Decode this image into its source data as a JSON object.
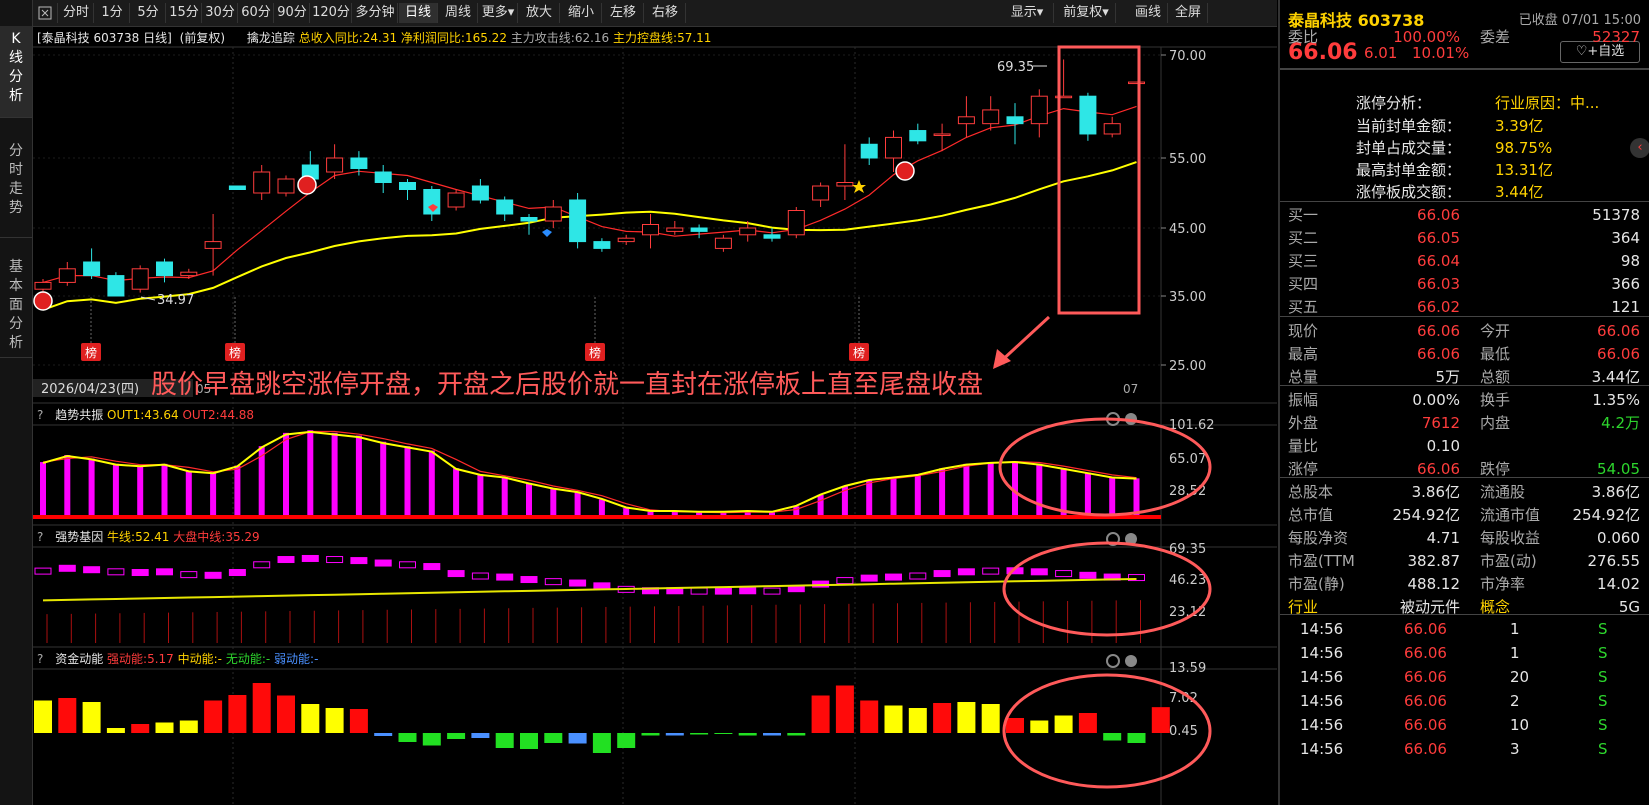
{
  "toolbar": {
    "items": [
      "分时",
      "1分",
      "5分",
      "15分",
      "30分",
      "60分",
      "90分",
      "120分",
      "多分钟",
      "日线",
      "周线",
      "更多▾",
      "放大",
      "缩小",
      "左移",
      "右移"
    ],
    "active": "日线",
    "right_items": [
      "显示▾",
      "前复权▾",
      "画线",
      "全屏"
    ]
  },
  "left_tabs": [
    "K\n线\n分\n析",
    "分\n时\n走\n势",
    "基\n本\n面\n分\n析"
  ],
  "chart": {
    "title": "[泰晶科技 603738 日线]",
    "adjust": "(前复权)",
    "indicator_name": "擒龙追踪",
    "ind1": "总收入同比:24.31",
    "ind2": "净利润同比:165.22",
    "ind3": "主力攻击线:62.16",
    "ind4": "主力控盘线:57.11",
    "high_label": "69.35",
    "low_label": "34.97",
    "date_label": "2026/04/23(四)",
    "date_tick_mid": "05",
    "date_tick_end": "07",
    "bang": "榜",
    "annotation": "股价早盘跳空涨停开盘，开盘之后股价就一直封在涨停板上直至尾盘收盘",
    "y_ticks": [
      "70.00",
      "55.00",
      "45.00",
      "35.00",
      "25.00"
    ],
    "y_vals": [
      70,
      55,
      45,
      35,
      25
    ]
  },
  "panel1": {
    "name": "趋势共振",
    "out1": "OUT1:43.64",
    "out2": "OUT2:44.88",
    "ticks": [
      "101.62",
      "65.07",
      "28.52"
    ]
  },
  "panel2": {
    "name": "强势基因",
    "l1": "牛线:52.41",
    "l2": "大盘中线:35.29",
    "ticks": [
      "69.35",
      "46.23",
      "23.12"
    ]
  },
  "panel3": {
    "name": "资金动能",
    "l1": "强动能:5.17",
    "l2": "中动能:-",
    "l3": "无动能:-",
    "l4": "弱动能:-",
    "ticks": [
      "13.59",
      "7.02",
      "0.45"
    ]
  },
  "colors": {
    "up": "#ff3c3c",
    "down": "#2ee6e6",
    "ma_red": "#ff2a2a",
    "ma_yellow": "#ffff00",
    "magenta": "#ff00ff",
    "annot": "#ff5a5a"
  },
  "candles": [
    {
      "o": 36,
      "c": 37,
      "h": 37.5,
      "l": 35.5
    },
    {
      "o": 37,
      "c": 39,
      "h": 40,
      "l": 36.5
    },
    {
      "o": 40,
      "c": 38,
      "h": 42,
      "l": 37.5
    },
    {
      "o": 38,
      "c": 35,
      "h": 38.5,
      "l": 34.97
    },
    {
      "o": 36,
      "c": 39,
      "h": 39.5,
      "l": 35.5
    },
    {
      "o": 40,
      "c": 38,
      "h": 40.5,
      "l": 37
    },
    {
      "o": 38,
      "c": 38.5,
      "h": 39,
      "l": 37.5
    },
    {
      "o": 42,
      "c": 43,
      "h": 47,
      "l": 38
    },
    {
      "o": 51,
      "c": 50.5,
      "h": 51,
      "l": 50.5
    },
    {
      "o": 50,
      "c": 53,
      "h": 54,
      "l": 49
    },
    {
      "o": 50,
      "c": 52,
      "h": 52.5,
      "l": 49.5
    },
    {
      "o": 54,
      "c": 52,
      "h": 56,
      "l": 51
    },
    {
      "o": 53,
      "c": 55,
      "h": 57,
      "l": 52
    },
    {
      "o": 55,
      "c": 53.5,
      "h": 56,
      "l": 52.5
    },
    {
      "o": 53,
      "c": 51.5,
      "h": 54,
      "l": 50
    },
    {
      "o": 51.5,
      "c": 50.5,
      "h": 52,
      "l": 49
    },
    {
      "o": 50.5,
      "c": 47,
      "h": 51,
      "l": 46
    },
    {
      "o": 48,
      "c": 50,
      "h": 50.5,
      "l": 47.5
    },
    {
      "o": 51,
      "c": 49,
      "h": 52,
      "l": 48.5
    },
    {
      "o": 49,
      "c": 47,
      "h": 49.5,
      "l": 46
    },
    {
      "o": 46.5,
      "c": 46,
      "h": 47,
      "l": 44
    },
    {
      "o": 46,
      "c": 48,
      "h": 49,
      "l": 45
    },
    {
      "o": 49,
      "c": 43,
      "h": 50,
      "l": 42
    },
    {
      "o": 43,
      "c": 42,
      "h": 43.5,
      "l": 41.5
    },
    {
      "o": 43,
      "c": 43.5,
      "h": 44,
      "l": 42.5
    },
    {
      "o": 44,
      "c": 45.5,
      "h": 47,
      "l": 42
    },
    {
      "o": 44.5,
      "c": 45,
      "h": 46,
      "l": 44
    },
    {
      "o": 45,
      "c": 44.5,
      "h": 45.5,
      "l": 43.5
    },
    {
      "o": 42,
      "c": 43.5,
      "h": 44,
      "l": 41.5
    },
    {
      "o": 44,
      "c": 45,
      "h": 46,
      "l": 43
    },
    {
      "o": 44,
      "c": 43.5,
      "h": 45,
      "l": 43
    },
    {
      "o": 44,
      "c": 47.5,
      "h": 48,
      "l": 43.5
    },
    {
      "o": 49,
      "c": 51,
      "h": 51.5,
      "l": 48
    },
    {
      "o": 51,
      "c": 51.5,
      "h": 57,
      "l": 49
    },
    {
      "o": 57,
      "c": 55,
      "h": 58,
      "l": 54
    },
    {
      "o": 55,
      "c": 58,
      "h": 59,
      "l": 53
    },
    {
      "o": 59,
      "c": 57.5,
      "h": 60,
      "l": 57
    },
    {
      "o": 58.5,
      "c": 58.5,
      "h": 60,
      "l": 56
    },
    {
      "o": 60,
      "c": 61,
      "h": 64,
      "l": 58
    },
    {
      "o": 60,
      "c": 62,
      "h": 64,
      "l": 59
    },
    {
      "o": 61,
      "c": 60,
      "h": 63,
      "l": 57
    },
    {
      "o": 60,
      "c": 64,
      "h": 65,
      "l": 58
    },
    {
      "o": 64,
      "c": 64,
      "h": 69.35,
      "l": 64
    },
    {
      "o": 64,
      "c": 58.5,
      "h": 64.5,
      "l": 57.5
    },
    {
      "o": 58.5,
      "c": 60,
      "h": 61,
      "l": 58
    },
    {
      "o": 66.06,
      "c": 66.06,
      "h": 66.06,
      "l": 66.06
    }
  ],
  "macd": [
    62,
    70,
    66,
    60,
    58,
    60,
    52,
    50,
    58,
    80,
    95,
    98,
    95,
    92,
    85,
    80,
    75,
    55,
    48,
    45,
    38,
    32,
    28,
    20,
    10,
    6,
    6,
    5,
    5,
    6,
    5,
    12,
    25,
    35,
    42,
    45,
    48,
    55,
    60,
    62,
    63,
    60,
    55,
    50,
    45,
    43.64
  ],
  "vol": [
    6.5,
    7.0,
    6.2,
    1.0,
    1.8,
    2.1,
    2.5,
    6.5,
    7.6,
    10,
    7.5,
    5.8,
    5.0,
    4.8,
    -0.6,
    -1.8,
    -2.5,
    -1.2,
    -1.0,
    -3.0,
    -3.2,
    -2.0,
    -2.1,
    -4.0,
    -3.0,
    -0.5,
    -0.5,
    -0.3,
    -0.2,
    -0.5,
    -0.5,
    -0.5,
    7.5,
    9.5,
    6.5,
    5.5,
    5.0,
    6.0,
    6.2,
    5.8,
    3.0,
    2.5,
    3.5,
    4.0,
    -1.5,
    -2.0,
    5.17
  ]
}
